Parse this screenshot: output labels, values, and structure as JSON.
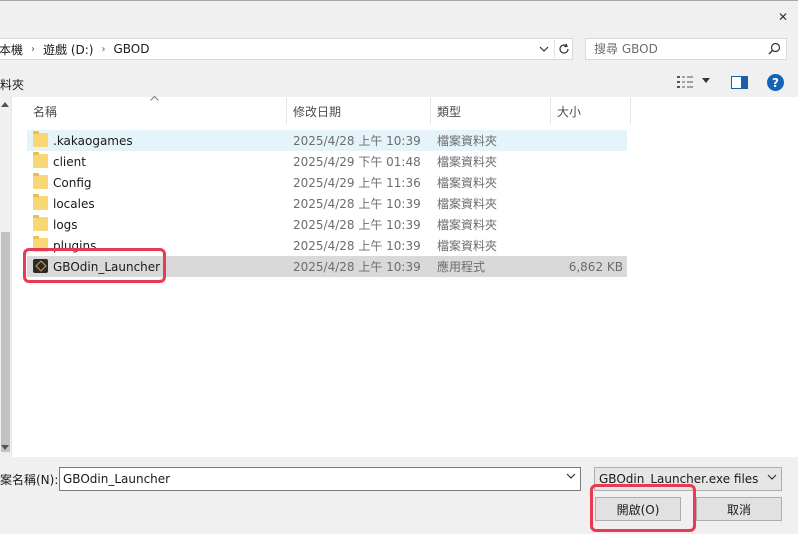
{
  "window": {
    "close_glyph": "✕"
  },
  "address": {
    "crumbs": [
      "本機",
      "遊戲 (D:)",
      "GBOD"
    ],
    "separator": "›"
  },
  "search": {
    "placeholder": "搜尋 GBOD"
  },
  "toolbar": {
    "new_folder_label": "料夾",
    "help_label": "?"
  },
  "columns": {
    "name": "名稱",
    "date": "修改日期",
    "type": "類型",
    "size": "大小"
  },
  "files": [
    {
      "name": ".kakaogames",
      "date": "2025/4/28 上午 10:39",
      "type": "檔案資料夾",
      "size": "",
      "icon": "folder-icon"
    },
    {
      "name": "client",
      "date": "2025/4/29 下午 01:48",
      "type": "檔案資料夾",
      "size": "",
      "icon": "folder-icon"
    },
    {
      "name": "Config",
      "date": "2025/4/29 上午 11:36",
      "type": "檔案資料夾",
      "size": "",
      "icon": "folder-icon"
    },
    {
      "name": "locales",
      "date": "2025/4/28 上午 10:39",
      "type": "檔案資料夾",
      "size": "",
      "icon": "folder-icon"
    },
    {
      "name": "logs",
      "date": "2025/4/28 上午 10:39",
      "type": "檔案資料夾",
      "size": "",
      "icon": "folder-icon"
    },
    {
      "name": "plugins",
      "date": "2025/4/28 上午 10:39",
      "type": "檔案資料夾",
      "size": "",
      "icon": "folder-icon"
    },
    {
      "name": "GBOdin_Launcher",
      "date": "2025/4/28 上午 10:39",
      "type": "應用程式",
      "size": "6,862 KB",
      "icon": "app-icon"
    }
  ],
  "filename": {
    "label": "案名稱(N):",
    "value": "GBOdin_Launcher"
  },
  "filetype": {
    "value": "GBOdin_Launcher.exe files (*.exe)"
  },
  "buttons": {
    "open": "開啟(O)",
    "cancel": "取消"
  },
  "colors": {
    "highlight": "#e83a52",
    "selected_row": "#d9d9d9",
    "hover_row": "#e5f3fb"
  }
}
